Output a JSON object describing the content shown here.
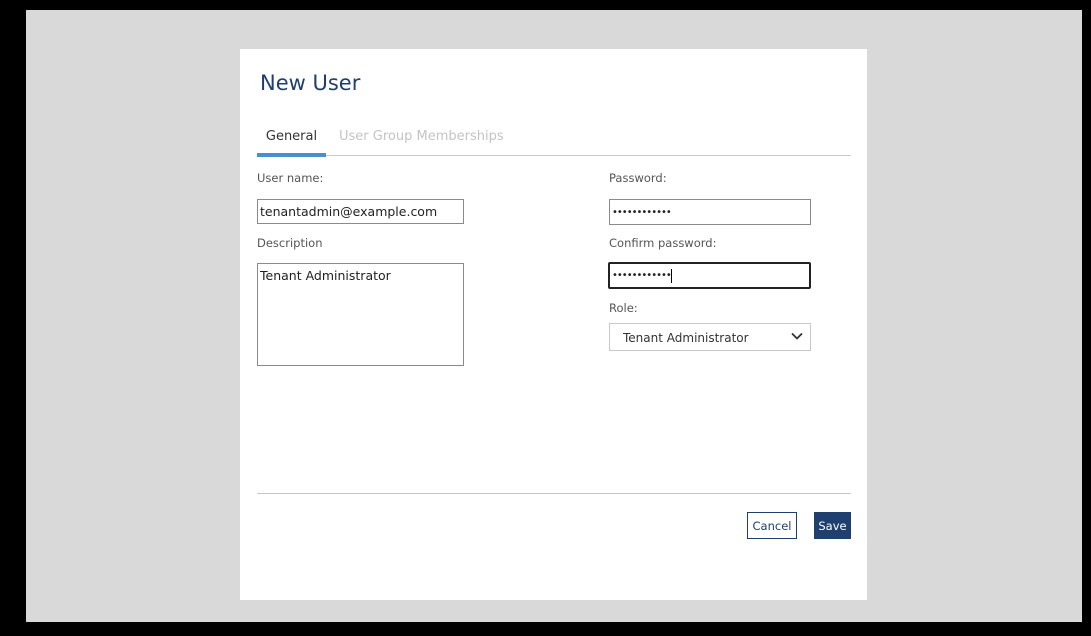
{
  "dialog": {
    "title": "New User",
    "tabs": [
      {
        "label": "General",
        "active": true
      },
      {
        "label": "User Group Memberships",
        "active": false
      }
    ]
  },
  "form": {
    "username": {
      "label": "User name:",
      "value": "tenantadmin@example.com"
    },
    "description": {
      "label": "Description",
      "value": "Tenant Administrator"
    },
    "password": {
      "label": "Password:",
      "value": "••••••••••••"
    },
    "confirm_password": {
      "label": "Confirm password:",
      "value": "••••••••••••"
    },
    "role": {
      "label": "Role:",
      "selected": "Tenant Administrator"
    }
  },
  "footer": {
    "cancel_label": "Cancel",
    "save_label": "Save"
  },
  "colors": {
    "brand_navy": "#1f3f6e",
    "tab_accent": "#4a8ecf",
    "backdrop": "#d9d9d9"
  },
  "icons": {
    "role_dropdown": "chevron-down-icon"
  }
}
